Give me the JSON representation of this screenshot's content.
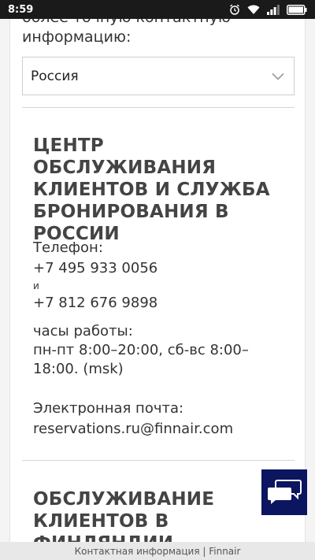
{
  "status_bar": {
    "time": "8:59"
  },
  "intro": {
    "text": "более точную контактную информацию:"
  },
  "country_select": {
    "value": "Россия"
  },
  "russia_section": {
    "heading_lines": [
      "ЦЕНТР ОБСЛУЖИВАНИЯ",
      "КЛИЕНТОВ И СЛУЖБА",
      "БРОНИРОВАНИЯ В",
      "РОССИИ"
    ],
    "phone_label": "Телефон:",
    "phone_1": "+7 495 933 0056",
    "conjunction": "и",
    "phone_2": "+7 812 676 9898",
    "hours_label": "часы работы:",
    "hours_line_1": "пн-пт 8:00–20:00, сб-вс 8:00–",
    "hours_line_2": "18:00. (msk)",
    "email_label": "Электронная почта:",
    "email": "reservations.ru@finnair.com"
  },
  "finland_section": {
    "heading_lines": [
      "ОБСЛУЖИВАНИЕ",
      "КЛИЕНТОВ В",
      "ФИНЛЯНДИИ"
    ]
  },
  "bottom_bar": {
    "title": "Контактная информация | Finnair"
  },
  "colors": {
    "status_bar_bg": "#1a1a1a",
    "chat_button_bg": "#0b1560",
    "heading_text": "#444444"
  }
}
